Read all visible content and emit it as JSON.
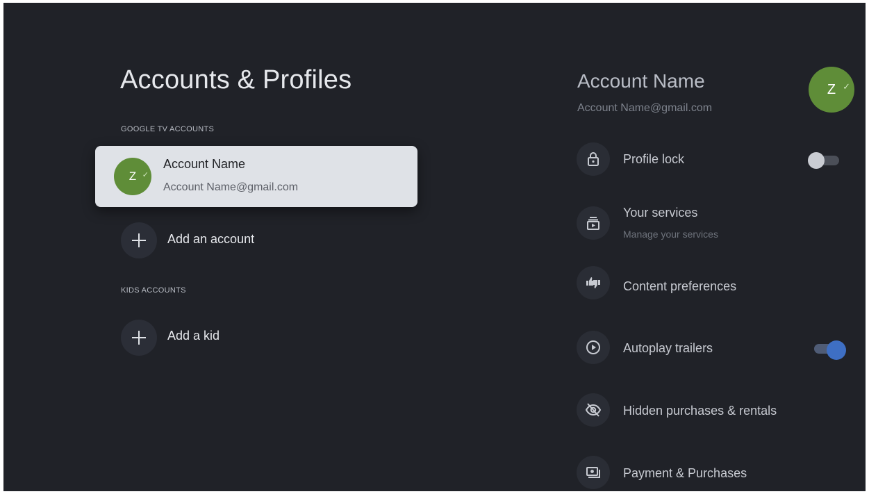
{
  "header": {
    "title": "Accounts & Profiles"
  },
  "google_accounts": {
    "section_label": "GOOGLE TV ACCOUNTS",
    "selected": {
      "avatar_letter": "Z",
      "name": "Account Name",
      "email": "Account Name@gmail.com"
    },
    "add_label": "Add an account"
  },
  "kids_accounts": {
    "section_label": "KIDS ACCOUNTS",
    "add_label": "Add a kid"
  },
  "detail": {
    "name": "Account Name",
    "email": "Account Name@gmail.com",
    "avatar_letter": "Z",
    "options": [
      {
        "label": "Profile lock",
        "icon": "lock-icon",
        "toggle": false
      },
      {
        "label": "Your services",
        "sublabel": "Manage your services",
        "icon": "services-icon"
      },
      {
        "label": "Content preferences",
        "icon": "thumbs-icon"
      },
      {
        "label": "Autoplay trailers",
        "icon": "play-circle-icon",
        "toggle": true
      },
      {
        "label": "Hidden purchases & rentals",
        "icon": "eye-off-icon"
      },
      {
        "label": "Payment & Purchases",
        "icon": "payment-icon"
      }
    ]
  },
  "colors": {
    "background": "#202228",
    "avatar": "#5f8d38",
    "toggle_on": "#3e6fc4",
    "card": "#dfe2e7"
  }
}
